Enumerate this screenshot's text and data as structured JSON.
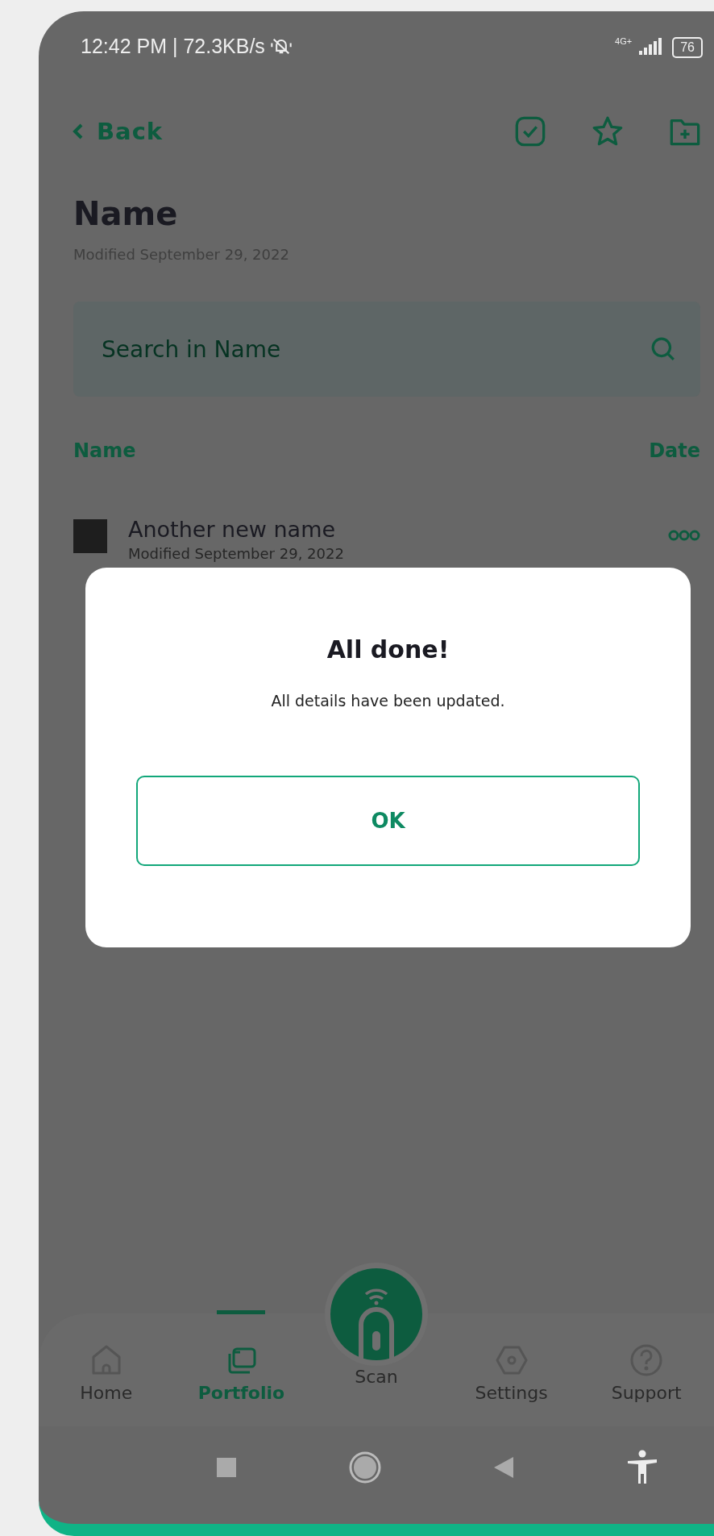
{
  "status_bar": {
    "time_and_speed": "12:42 PM | 72.3KB/s",
    "network": "4G+",
    "battery": "76"
  },
  "toolbar": {
    "back": "Back"
  },
  "header": {
    "title": "Name",
    "subtitle": "Modified September 29, 2022"
  },
  "search": {
    "placeholder": "Search in Name"
  },
  "columns": [
    "Name",
    "Date"
  ],
  "rows": [
    {
      "name": "Another new name",
      "modified": "Modified September 29, 2022"
    }
  ],
  "dialog": {
    "title": "All done!",
    "message": "All details have been updated.",
    "button": "OK"
  },
  "bottom_nav": [
    {
      "label": "Home",
      "selected": false,
      "kind": "tab"
    },
    {
      "label": "Portfolio",
      "selected": true,
      "kind": "tab"
    },
    {
      "label": "Scan",
      "selected": false,
      "kind": "center"
    },
    {
      "label": "Settings",
      "selected": false,
      "kind": "tab"
    },
    {
      "label": "Support",
      "selected": false,
      "kind": "tab"
    }
  ]
}
